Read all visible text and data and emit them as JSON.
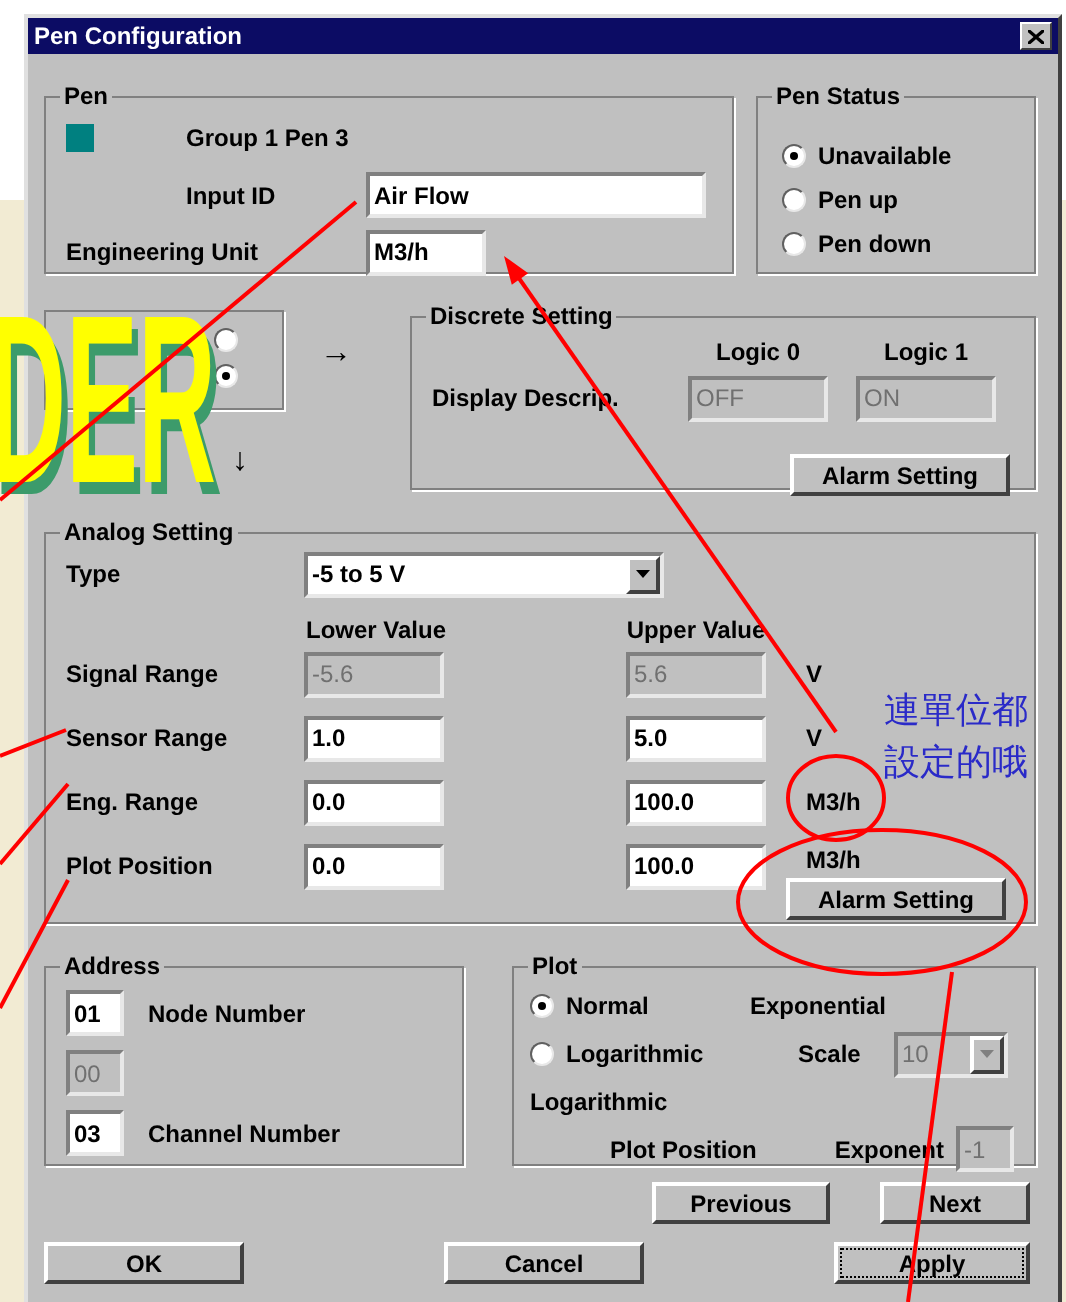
{
  "window": {
    "title": "Pen Configuration"
  },
  "pen": {
    "title": "Pen",
    "color": "#008080",
    "group_label": "Group 1 Pen 3",
    "input_id_label": "Input ID",
    "input_id": "Air Flow",
    "unit_label": "Engineering Unit",
    "unit": "M3/h"
  },
  "pen_status": {
    "title": "Pen Status",
    "options": [
      {
        "label": "Unavailable",
        "selected": true
      },
      {
        "label": "Pen up",
        "selected": false
      },
      {
        "label": "Pen down",
        "selected": false
      }
    ]
  },
  "input_type": {
    "options": [
      {
        "selected": false
      },
      {
        "selected": true
      }
    ]
  },
  "arrows": [
    "→",
    "↓"
  ],
  "discrete": {
    "title": "Discrete Setting",
    "label": "Display Descrip.",
    "columns": [
      "Logic 0",
      "Logic 1"
    ],
    "values": [
      "OFF",
      "ON"
    ],
    "disabled": true,
    "alarm_button": "Alarm Setting"
  },
  "analog": {
    "title": "Analog Setting",
    "type_label": "Type",
    "type_value": "-5 to 5 V",
    "columns": [
      "Lower Value",
      "Upper Value"
    ],
    "rows": [
      {
        "label": "Signal Range",
        "lower": "-5.6",
        "upper": "5.6",
        "unit": "V",
        "disabled": true
      },
      {
        "label": "Sensor Range",
        "lower": "1.0",
        "upper": "5.0",
        "unit": "V",
        "disabled": false
      },
      {
        "label": "Eng. Range",
        "lower": "0.0",
        "upper": "100.0",
        "unit": "M3/h",
        "disabled": false
      },
      {
        "label": "Plot Position",
        "lower": "0.0",
        "upper": "100.0",
        "unit": "M3/h",
        "disabled": false
      }
    ],
    "alarm_button": "Alarm Setting"
  },
  "address": {
    "title": "Address",
    "fields": [
      {
        "value": "01",
        "label": "Node Number",
        "disabled": false
      },
      {
        "value": "00",
        "disabled": true
      },
      {
        "value": "03",
        "label": "Channel Number",
        "disabled": false
      }
    ]
  },
  "plot": {
    "title": "Plot",
    "options": [
      {
        "label": "Normal",
        "selected": true
      },
      {
        "label": "Logarithmic",
        "selected": false
      }
    ],
    "log_label": "Logarithmic",
    "exp_label": "Exponential",
    "scale_label": "Scale",
    "scale_value": "10",
    "scale_disabled": true,
    "position_label": "Plot Position",
    "exponent_label": "Exponent",
    "exponent_value": "-1",
    "exponent_disabled": true
  },
  "nav_buttons": [
    "Previous",
    "Next"
  ],
  "buttons": [
    {
      "label": "OK",
      "focused": false
    },
    {
      "label": "Cancel",
      "focused": false
    },
    {
      "label": "Apply",
      "focused": true
    }
  ],
  "slide": {
    "title_fragment": "DER",
    "note_lines": [
      "連單位都",
      "設定的哦"
    ]
  }
}
